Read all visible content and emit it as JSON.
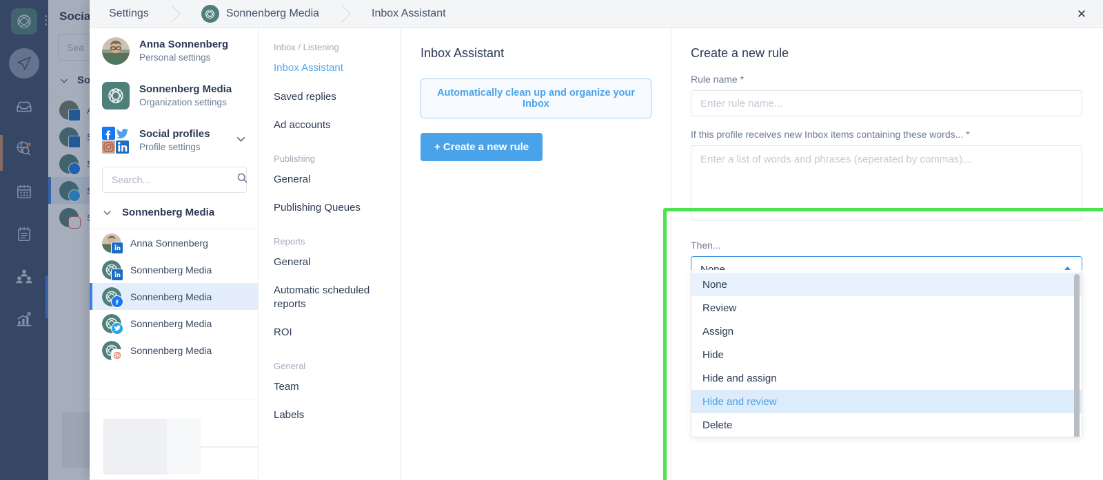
{
  "background": {
    "panel_title": "Social",
    "search_placeholder": "Sea",
    "group_label": "So",
    "rows": [
      "A",
      "S",
      "S",
      "S",
      "S"
    ],
    "rail_icons": [
      "brand-logo-icon",
      "compose-icon",
      "inbox-icon",
      "listening-icon",
      "calendar-icon",
      "planner-icon",
      "team-icon",
      "analytics-icon"
    ]
  },
  "header": {
    "breadcrumbs": [
      {
        "label": "Settings",
        "has_logo": false
      },
      {
        "label": "Sonnenberg Media",
        "has_logo": true
      },
      {
        "label": "Inbox Assistant",
        "has_logo": false
      }
    ],
    "close_label": "✕"
  },
  "accounts": {
    "items": [
      {
        "name": "Anna Sonnenberg",
        "sub": "Personal settings",
        "avatar": "person-photo-avatar"
      },
      {
        "name": "Sonnenberg Media",
        "sub": "Organization settings",
        "avatar": "organization-logo-avatar"
      },
      {
        "name": "Social profiles",
        "sub": "Profile settings",
        "avatar": "social-networks-grid-avatar",
        "chevron": true
      }
    ],
    "search_placeholder": "Search...",
    "search_value": "",
    "group_label": "Sonnenberg Media",
    "profiles": [
      {
        "name": "Anna Sonnenberg",
        "network": "linkedin",
        "avatar": "person-photo-avatar",
        "selected": false
      },
      {
        "name": "Sonnenberg Media",
        "network": "linkedin",
        "avatar": "organization-logo-avatar",
        "selected": false
      },
      {
        "name": "Sonnenberg Media",
        "network": "facebook",
        "avatar": "organization-logo-avatar",
        "selected": true
      },
      {
        "name": "Sonnenberg Media",
        "network": "twitter",
        "avatar": "organization-logo-avatar",
        "selected": false
      },
      {
        "name": "Sonnenberg Media",
        "network": "instagram",
        "avatar": "organization-logo-avatar",
        "selected": false
      }
    ]
  },
  "settings_nav": {
    "sections": [
      {
        "label": "Inbox / Listening",
        "items": [
          {
            "label": "Inbox Assistant",
            "active": true
          },
          {
            "label": "Saved replies",
            "active": false
          },
          {
            "label": "Ad accounts",
            "active": false
          }
        ]
      },
      {
        "label": "Publishing",
        "items": [
          {
            "label": "General",
            "active": false
          },
          {
            "label": "Publishing Queues",
            "active": false
          }
        ]
      },
      {
        "label": "Reports",
        "items": [
          {
            "label": "General",
            "active": false
          },
          {
            "label": "Automatic scheduled reports",
            "active": false
          },
          {
            "label": "ROI",
            "active": false
          }
        ]
      },
      {
        "label": "General",
        "items": [
          {
            "label": "Team",
            "active": false
          },
          {
            "label": "Labels",
            "active": false
          }
        ]
      }
    ]
  },
  "inbox_assistant": {
    "title": "Inbox Assistant",
    "info_text": "Automatically clean up and organize your Inbox",
    "create_button": "+ Create a new rule"
  },
  "create_rule": {
    "title": "Create a new rule",
    "rule_name_label": "Rule name *",
    "rule_name_placeholder": "Enter rule name...",
    "rule_name_value": "",
    "words_label": "If this profile receives new Inbox items containing these words... *",
    "words_placeholder": "Enter a list of words and phrases (seperated by commas)...",
    "words_value": "",
    "then_label": "Then...",
    "then_selected": "None",
    "then_options": [
      {
        "label": "None",
        "state": "highlighted"
      },
      {
        "label": "Review",
        "state": "normal"
      },
      {
        "label": "Assign",
        "state": "normal"
      },
      {
        "label": "Hide",
        "state": "normal"
      },
      {
        "label": "Hide and assign",
        "state": "normal"
      },
      {
        "label": "Hide and review",
        "state": "hovered"
      },
      {
        "label": "Delete",
        "state": "normal"
      }
    ]
  },
  "colors": {
    "accent_blue": "#4aa3e8",
    "highlight_green": "#4fe24f",
    "rail_navy": "#3d4f6d",
    "brand_teal": "#4f7f7b",
    "selected_row_blue": "#e4eefb"
  }
}
